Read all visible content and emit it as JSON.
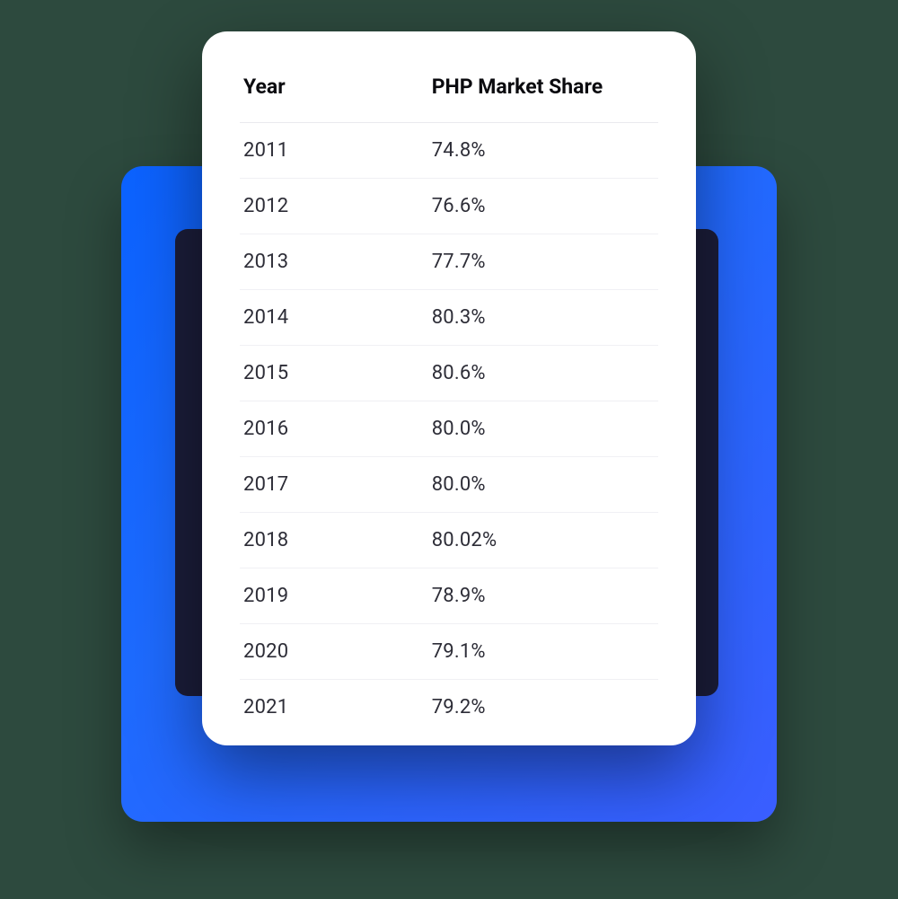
{
  "chart_data": {
    "type": "table",
    "title": "",
    "columns": [
      "Year",
      "PHP Market Share"
    ],
    "rows": [
      {
        "year": "2011",
        "share": "74.8%"
      },
      {
        "year": "2012",
        "share": "76.6%"
      },
      {
        "year": "2013",
        "share": "77.7%"
      },
      {
        "year": "2014",
        "share": "80.3%"
      },
      {
        "year": "2015",
        "share": "80.6%"
      },
      {
        "year": "2016",
        "share": "80.0%"
      },
      {
        "year": "2017",
        "share": "80.0%"
      },
      {
        "year": "2018",
        "share": "80.02%"
      },
      {
        "year": "2019",
        "share": "78.9%"
      },
      {
        "year": "2020",
        "share": "79.1%"
      },
      {
        "year": "2021",
        "share": "79.2%"
      }
    ]
  },
  "colors": {
    "background": "#2d4a3e",
    "accent_blue": "#1e6bff",
    "card": "#ffffff",
    "text_dark": "#0b0b0f",
    "text_body": "#2d2d37",
    "divider": "#f0f0f4"
  }
}
